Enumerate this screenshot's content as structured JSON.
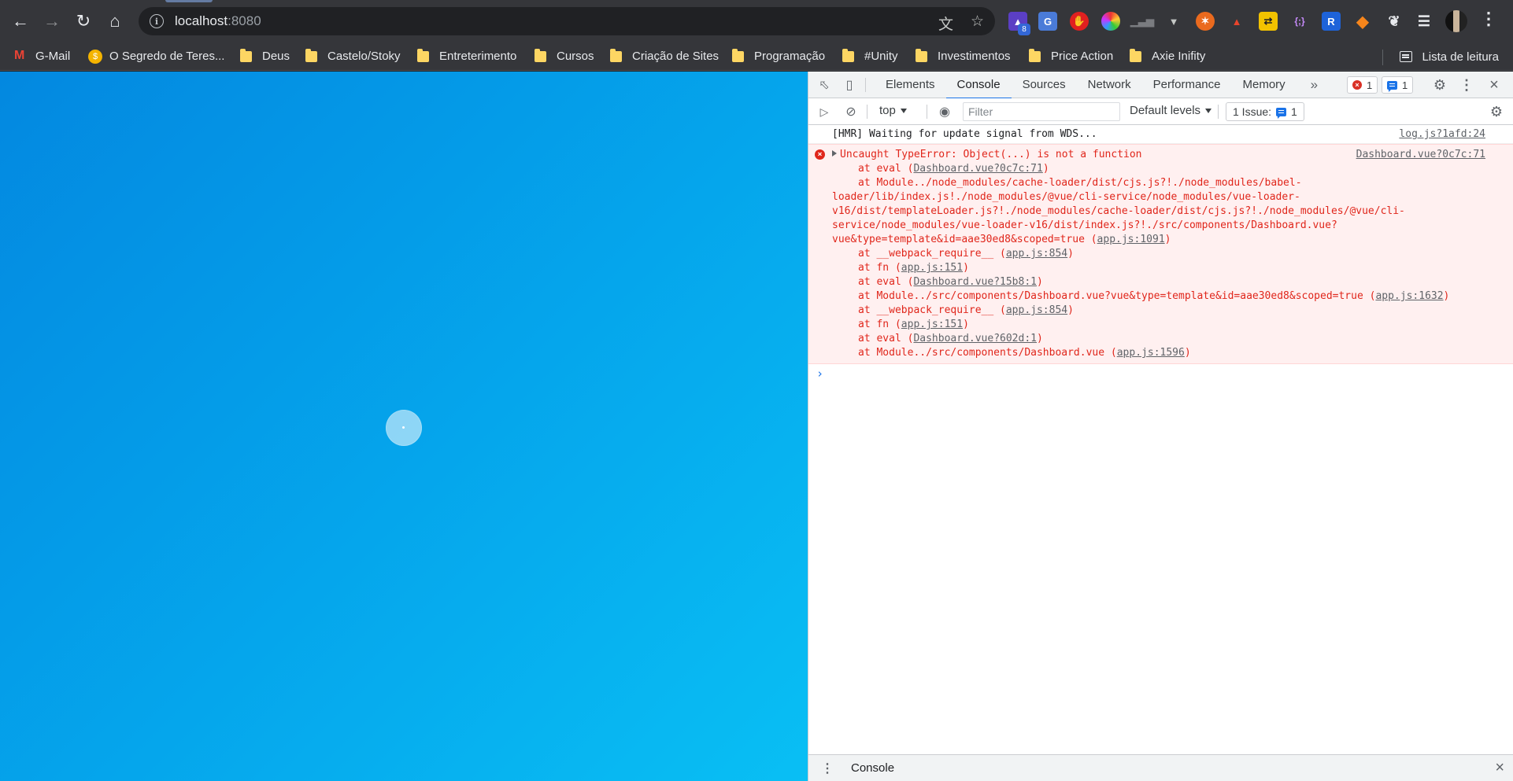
{
  "browser": {
    "url_host": "localhost",
    "url_port": ":8080",
    "extension_badge": "8",
    "bookmarks": [
      {
        "label": "G-Mail",
        "icon": "gmail-icon"
      },
      {
        "label": "O Segredo de Teres...",
        "icon": "coin-icon"
      },
      {
        "label": "Deus",
        "icon": "folder-icon"
      },
      {
        "label": "Castelo/Stoky",
        "icon": "folder-icon"
      },
      {
        "label": "Entreterimento",
        "icon": "folder-icon"
      },
      {
        "label": "Cursos",
        "icon": "folder-icon"
      },
      {
        "label": "Criação de Sites",
        "icon": "folder-icon"
      },
      {
        "label": "Programação",
        "icon": "folder-icon"
      },
      {
        "label": "#Unity",
        "icon": "folder-icon"
      },
      {
        "label": "Investimentos",
        "icon": "folder-icon"
      },
      {
        "label": "Price Action",
        "icon": "folder-icon"
      },
      {
        "label": "Axie Inifity",
        "icon": "folder-icon"
      }
    ],
    "reading_list": "Lista de leitura"
  },
  "devtools": {
    "tabs": [
      "Elements",
      "Console",
      "Sources",
      "Network",
      "Performance",
      "Memory"
    ],
    "active_tab": "Console",
    "error_count": "1",
    "message_count": "1",
    "context": "top",
    "filter_placeholder": "Filter",
    "levels": "Default levels",
    "issues_label": "1 Issue:",
    "issues_count": "1",
    "log": {
      "text": "[HMR] Waiting for update signal from WDS...",
      "source": "log.js?1afd:24"
    },
    "error": {
      "message": "Uncaught TypeError: Object(...) is not a function",
      "source": "Dashboard.vue?0c7c:71",
      "stack": [
        {
          "pre": "at eval (",
          "link": "Dashboard.vue?0c7c:71",
          "post": ")",
          "indent": true
        },
        {
          "pre": "at Module../node_modules/cache-loader/dist/cjs.js?!./node_modules/babel-",
          "link": "",
          "post": "",
          "indent": true
        },
        {
          "pre": "loader/lib/index.js!./node_modules/@vue/cli-service/node_modules/vue-loader-",
          "link": "",
          "post": "",
          "indent": false
        },
        {
          "pre": "v16/dist/templateLoader.js?!./node_modules/cache-loader/dist/cjs.js?!./node_modules/@vue/cli-",
          "link": "",
          "post": "",
          "indent": false
        },
        {
          "pre": "service/node_modules/vue-loader-v16/dist/index.js?!./src/components/Dashboard.vue?",
          "link": "",
          "post": "",
          "indent": false
        },
        {
          "pre": "vue&type=template&id=aae30ed8&scoped=true (",
          "link": "app.js:1091",
          "post": ")",
          "indent": false
        },
        {
          "pre": "at __webpack_require__ (",
          "link": "app.js:854",
          "post": ")",
          "indent": true
        },
        {
          "pre": "at fn (",
          "link": "app.js:151",
          "post": ")",
          "indent": true
        },
        {
          "pre": "at eval (",
          "link": "Dashboard.vue?15b8:1",
          "post": ")",
          "indent": true
        },
        {
          "pre": "at Module../src/components/Dashboard.vue?vue&type=template&id=aae30ed8&scoped=true (",
          "link": "app.js:1632",
          "post": ")",
          "indent": true
        },
        {
          "pre": "at __webpack_require__ (",
          "link": "app.js:854",
          "post": ")",
          "indent": true
        },
        {
          "pre": "at fn (",
          "link": "app.js:151",
          "post": ")",
          "indent": true
        },
        {
          "pre": "at eval (",
          "link": "Dashboard.vue?602d:1",
          "post": ")",
          "indent": true
        },
        {
          "pre": "at Module../src/components/Dashboard.vue (",
          "link": "app.js:1596",
          "post": ")",
          "indent": true
        }
      ]
    },
    "drawer_label": "Console"
  },
  "colors": {
    "page_gradient_start": "#0388e0",
    "page_gradient_end": "#09bff4",
    "error_text": "#e0261b",
    "error_bg": "#fff0f0"
  }
}
